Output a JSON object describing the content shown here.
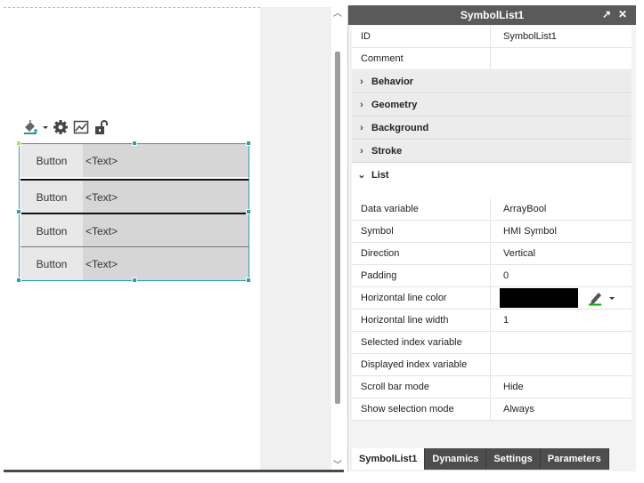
{
  "canvas": {
    "list_rows": [
      {
        "button": "Button",
        "text": "<Text>"
      },
      {
        "button": "Button",
        "text": "<Text>"
      },
      {
        "button": "Button",
        "text": "<Text>"
      },
      {
        "button": "Button",
        "text": "<Text>"
      }
    ],
    "toolbar_icons": [
      "paint-bucket-icon",
      "dropdown-arrow-icon",
      "gear-icon",
      "chart-icon",
      "unlock-icon"
    ]
  },
  "panel": {
    "title": "SymbolList1",
    "top_rows": [
      {
        "key": "ID",
        "value": "SymbolList1"
      },
      {
        "key": "Comment",
        "value": ""
      }
    ],
    "sections": [
      "Behavior",
      "Geometry",
      "Background",
      "Stroke",
      "List"
    ],
    "list_rows": [
      {
        "key": "Data variable",
        "value": "ArrayBool"
      },
      {
        "key": "Symbol",
        "value": "HMI Symbol"
      },
      {
        "key": "Direction",
        "value": "Vertical"
      },
      {
        "key": "Padding",
        "value": "0"
      },
      {
        "key": "Horizontal line color",
        "value": "",
        "color": "#000000"
      },
      {
        "key": "Horizontal line width",
        "value": "1"
      },
      {
        "key": "Selected index variable",
        "value": ""
      },
      {
        "key": "Displayed index variable",
        "value": ""
      },
      {
        "key": "Scroll bar mode",
        "value": "Hide"
      },
      {
        "key": "Show selection mode",
        "value": "Always"
      }
    ],
    "tabs": [
      "SymbolList1",
      "Dynamics",
      "Settings",
      "Parameters"
    ],
    "active_tab": "SymbolList1"
  },
  "colors": {
    "selection": "#27a0a8",
    "panel_header": "#5a5a5a",
    "tab_bg": "#4d4d4d"
  }
}
